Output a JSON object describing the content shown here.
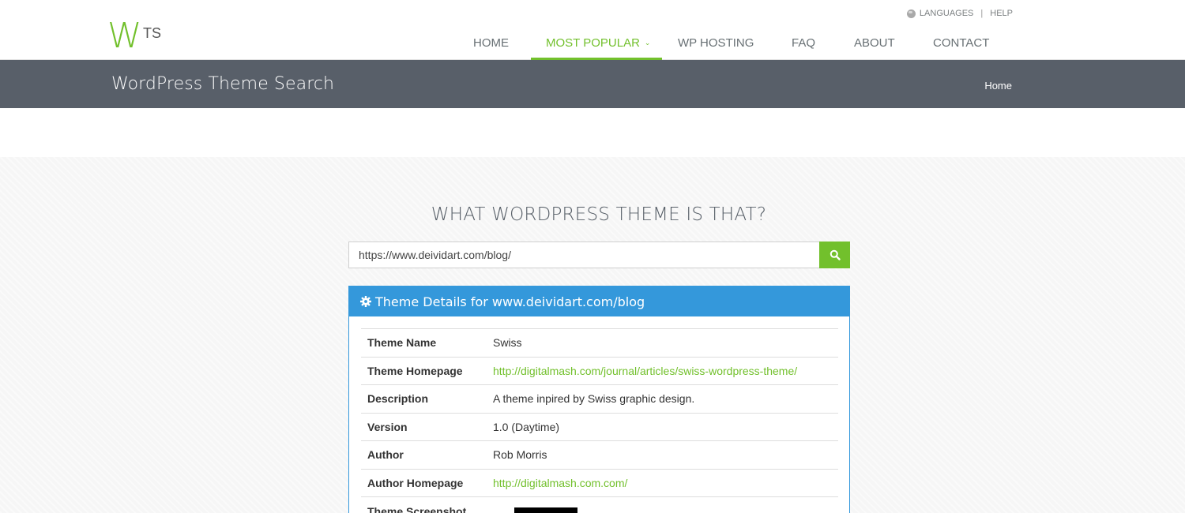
{
  "topbar": {
    "languages": "LANGUAGES",
    "separator": "|",
    "help": "HELP"
  },
  "logo": {
    "w": "W",
    "ts": "TS"
  },
  "nav": {
    "home": "HOME",
    "most_popular": "MOST POPULAR",
    "wp_hosting": "WP HOSTING",
    "faq": "FAQ",
    "about": "ABOUT",
    "contact": "CONTACT"
  },
  "breadcrumbs": {
    "title": "WordPress Theme Search",
    "home": "Home"
  },
  "main": {
    "heading": "WHAT WORDPRESS THEME IS THAT?"
  },
  "search": {
    "value": "https://www.deividart.com/blog/"
  },
  "panel": {
    "title": "Theme Details for www.deividart.com/blog",
    "rows": [
      {
        "key": "Theme Name",
        "value": "Swiss"
      },
      {
        "key": "Theme Homepage",
        "value": "http://digitalmash.com/journal/articles/swiss-wordpress-theme/"
      },
      {
        "key": "Description",
        "value": "A theme inpired by Swiss graphic design."
      },
      {
        "key": "Version",
        "value": "1.0 (Daytime)"
      },
      {
        "key": "Author",
        "value": "Rob Morris"
      },
      {
        "key": "Author Homepage",
        "value": "http://digitalmash.com.com/"
      },
      {
        "key": "Theme Screenshot",
        "value": ""
      }
    ]
  },
  "colors": {
    "accent": "#72c02c",
    "panel": "#3498db",
    "breadcrumb_bg": "#585f69"
  }
}
